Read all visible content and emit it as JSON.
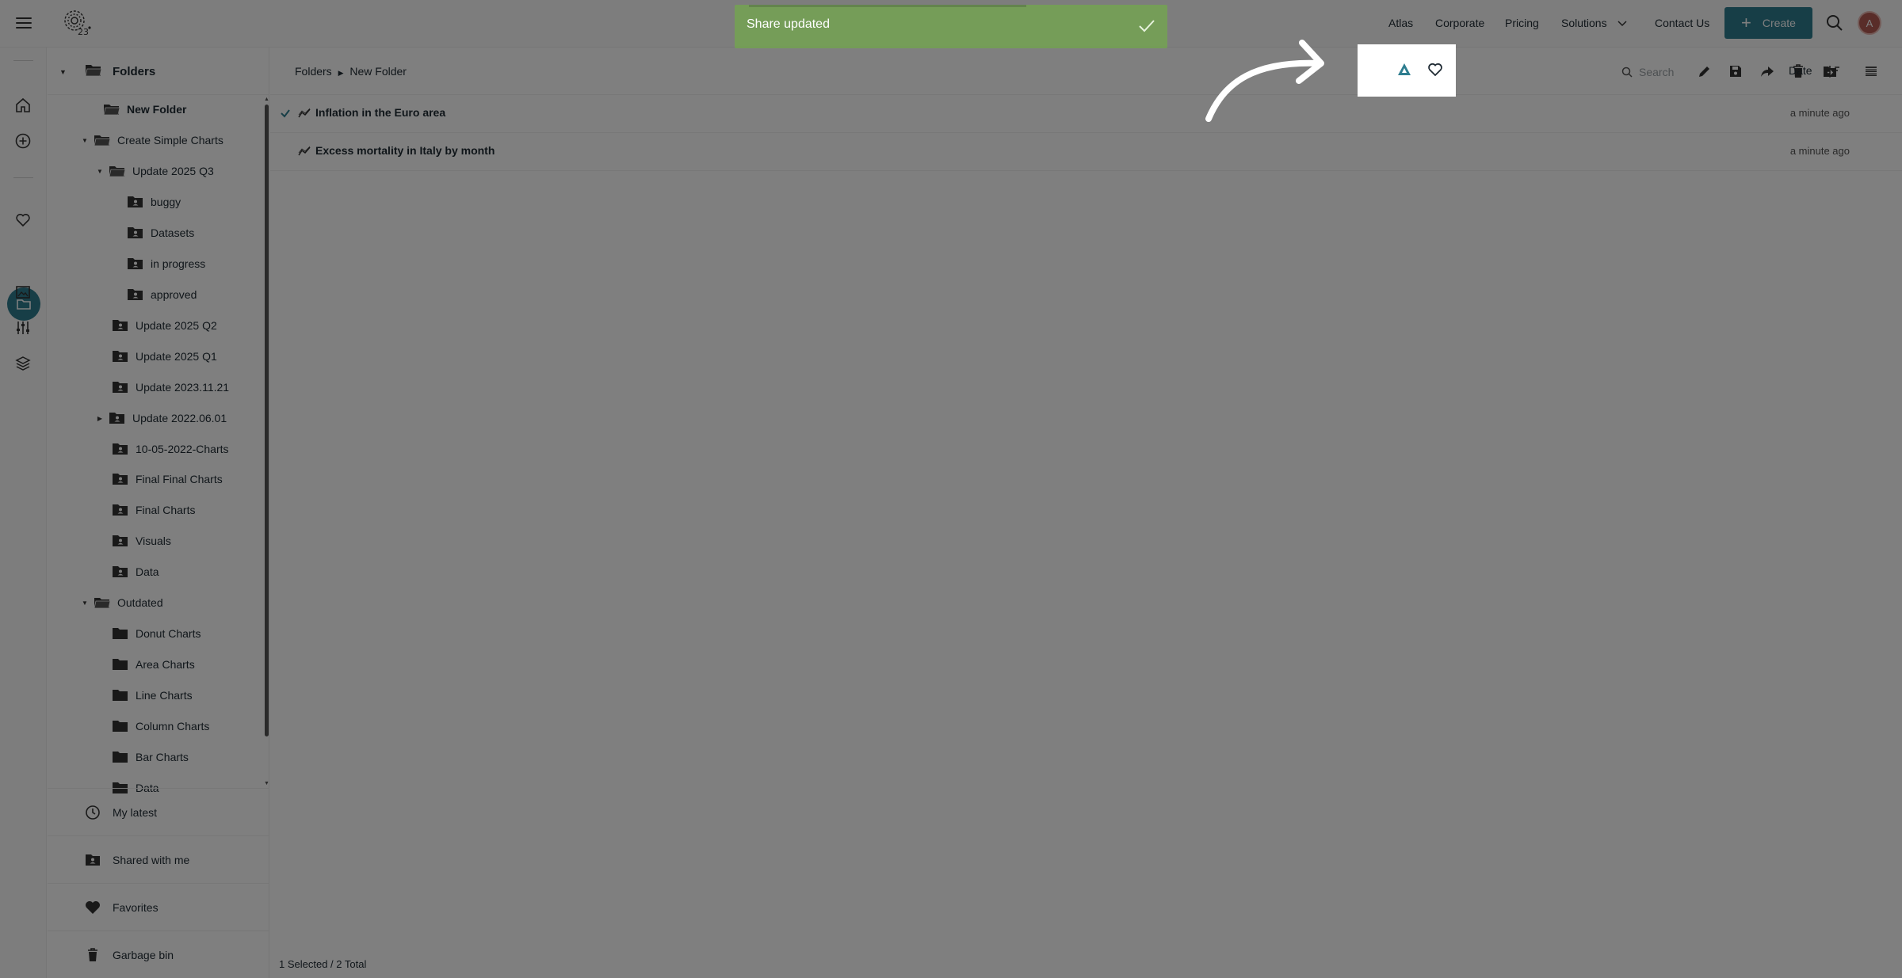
{
  "header": {
    "nav": {
      "atlas": "Atlas",
      "corporate": "Corporate",
      "pricing": "Pricing",
      "solutions": "Solutions",
      "contact": "Contact Us"
    },
    "create_label": "Create",
    "avatar_initial": "A",
    "accent_color": "#2e7d8f"
  },
  "toast": {
    "message": "Share updated",
    "color": "#6fb83b"
  },
  "rail": {
    "icons": [
      "home-icon",
      "add-circle-icon",
      "heart-icon",
      "folder-icon",
      "image-icon",
      "sliders-icon",
      "layers-icon"
    ],
    "active": "folder-icon"
  },
  "panel": {
    "title": "Folders",
    "tree": [
      {
        "label": "New Folder",
        "bold": true
      },
      {
        "label": "Create Simple Charts"
      },
      {
        "label": "Update 2025 Q3"
      },
      {
        "label": "buggy"
      },
      {
        "label": "Datasets"
      },
      {
        "label": "in progress"
      },
      {
        "label": "approved"
      },
      {
        "label": "Update 2025 Q2"
      },
      {
        "label": "Update 2025 Q1"
      },
      {
        "label": "Update 2023.11.21"
      },
      {
        "label": "Update 2022.06.01"
      },
      {
        "label": "10-05-2022-Charts"
      },
      {
        "label": "Final Final Charts"
      },
      {
        "label": "Final Charts"
      },
      {
        "label": "Visuals"
      },
      {
        "label": "Data"
      },
      {
        "label": "Outdated"
      },
      {
        "label": "Donut Charts"
      },
      {
        "label": "Area Charts"
      },
      {
        "label": "Line Charts"
      },
      {
        "label": "Column Charts"
      },
      {
        "label": "Bar Charts"
      },
      {
        "label": "Data"
      }
    ],
    "bottom": {
      "latest": "My latest",
      "shared": "Shared with me",
      "favorites": "Favorites",
      "garbage": "Garbage bin"
    }
  },
  "content": {
    "breadcrumb": {
      "root": "Folders",
      "current": "New Folder"
    },
    "search_placeholder": "Search",
    "sort_label": "Date",
    "files": [
      {
        "name": "Inflation in the Euro area",
        "date": "a minute ago",
        "selected": true
      },
      {
        "name": "Excess mortality in Italy by month",
        "date": "a minute ago",
        "selected": false
      }
    ],
    "status": "1 Selected / 2 Total"
  }
}
